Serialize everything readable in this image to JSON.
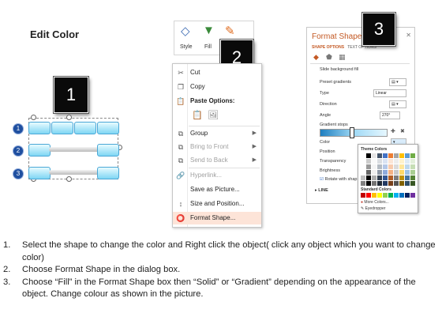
{
  "title": "Edit Color",
  "badges": [
    "1",
    "2",
    "3"
  ],
  "diagram": {
    "numbers": [
      "1",
      "2",
      "3"
    ]
  },
  "ribbon": {
    "style_label": "Style",
    "fill_label": "Fill",
    "outline_label": "O"
  },
  "context_menu": {
    "cut": "Cut",
    "copy": "Copy",
    "paste_options": "Paste Options:",
    "group": "Group",
    "bring_to_front": "Bring to Front",
    "send_to_back": "Send to Back",
    "hyperlink": "Hyperlink...",
    "save_as_picture": "Save as Picture...",
    "size_and_position": "Size and Position...",
    "format_shape": "Format Shape..."
  },
  "format_pane": {
    "title": "Format Shape",
    "tab_shape": "SHAPE OPTIONS",
    "tab_text": "TEXT OPTIONS",
    "slide_bg": "Slide background fill",
    "preset_gradients": "Preset gradients",
    "type_label": "Type",
    "type_value": "Linear",
    "direction_label": "Direction",
    "angle_label": "Angle",
    "angle_value": "270°",
    "gradient_stops": "Gradient stops",
    "color_label": "Color",
    "position_label": "Position",
    "transparency_label": "Transparency",
    "brightness_label": "Brightness",
    "rotate_label": "Rotate with shap",
    "line_label": "LINE"
  },
  "color_popup": {
    "theme_colors": "Theme Colors",
    "standard_colors": "Standard Colors",
    "more_colors": "More Colors...",
    "eyedropper": "Eyedropper",
    "theme_top": [
      "#ffffff",
      "#000000",
      "#e7e6e6",
      "#44546a",
      "#4472c4",
      "#ed7d31",
      "#a5a5a5",
      "#ffc000",
      "#5b9bd5",
      "#70ad47"
    ],
    "standard": [
      "#c00000",
      "#ff0000",
      "#ffc000",
      "#ffff00",
      "#92d050",
      "#00b050",
      "#00b0f0",
      "#0070c0",
      "#002060",
      "#7030a0"
    ]
  },
  "instructions": [
    {
      "n": "1.",
      "text": "Select the shape to change the color and Right click the object( click any object which you want to change color)"
    },
    {
      "n": "2.",
      "text": "Choose Format Shape in the dialog box."
    },
    {
      "n": "3.",
      "text": "Choose “Fill” in the Format Shape box then “Solid” or “Gradient” depending on the appearance of the object. Change colour as shown in the picture."
    }
  ]
}
